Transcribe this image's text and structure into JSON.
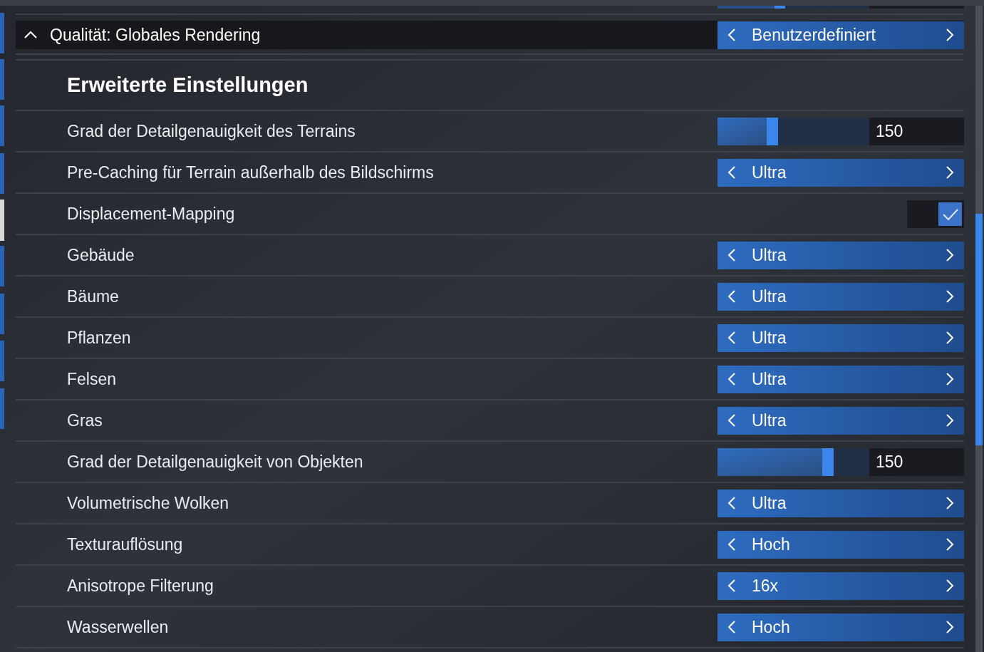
{
  "section": {
    "title": "Qualität: Globales Rendering",
    "expanded": true,
    "value": "Benutzerdefiniert"
  },
  "heading": "Erweiterte Einstellungen",
  "settings": [
    {
      "kind": "slider",
      "label": "Grad der Detailgenauigkeit des Terrains",
      "level": 0.36,
      "value": "150"
    },
    {
      "kind": "stepper",
      "label": "Pre-Caching für Terrain außerhalb des Bildschirms",
      "value": "Ultra"
    },
    {
      "kind": "checkbox",
      "label": "Displacement-Mapping",
      "checked": true
    },
    {
      "kind": "stepper",
      "label": "Gebäude",
      "value": "Ultra"
    },
    {
      "kind": "stepper",
      "label": "Bäume",
      "value": "Ultra"
    },
    {
      "kind": "stepper",
      "label": "Pflanzen",
      "value": "Ultra"
    },
    {
      "kind": "stepper",
      "label": "Felsen",
      "value": "Ultra"
    },
    {
      "kind": "stepper",
      "label": "Gras",
      "value": "Ultra"
    },
    {
      "kind": "slider",
      "label": "Grad der Detailgenauigkeit von Objekten",
      "level": 0.73,
      "value": "150"
    },
    {
      "kind": "stepper",
      "label": "Volumetrische Wolken",
      "value": "Ultra"
    },
    {
      "kind": "stepper",
      "label": "Texturauflösung",
      "value": "Hoch"
    },
    {
      "kind": "stepper",
      "label": "Anisotrope Filterung",
      "value": "16x"
    },
    {
      "kind": "stepper",
      "label": "Wasserwellen",
      "value": "Hoch"
    }
  ]
}
